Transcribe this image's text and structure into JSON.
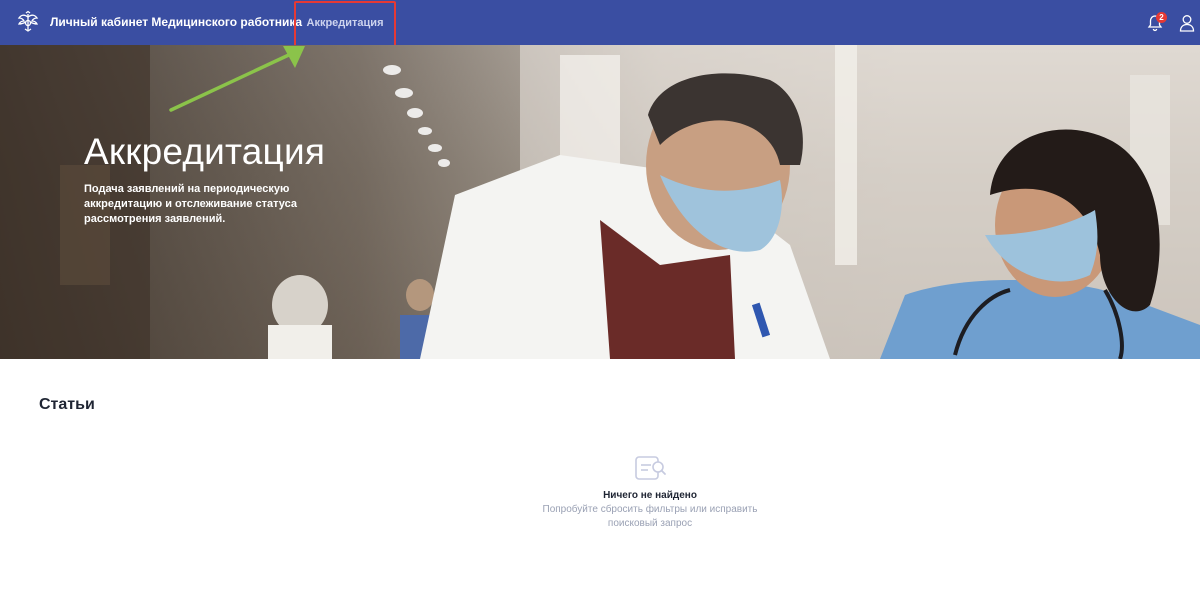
{
  "header": {
    "app_title": "Личный кабинет Медицинского работника",
    "nav_active": "Аккредитация",
    "notifications_count": "2",
    "brand_color": "#3a4ea2",
    "icons": [
      "emblem-icon",
      "bell-icon",
      "user-icon"
    ]
  },
  "hero": {
    "title": "Аккредитация",
    "description": "Подача заявлений на периодическую аккредитацию и отслеживание статуса рассмотрения заявлений."
  },
  "articles": {
    "title": "Статьи",
    "empty_title": "Ничего не найдено",
    "empty_hint": "Попробуйте сбросить фильтры или исправить поисковый запрос"
  },
  "annotation": {
    "highlight_color": "#e53935",
    "arrow_color": "#8bc34a"
  }
}
